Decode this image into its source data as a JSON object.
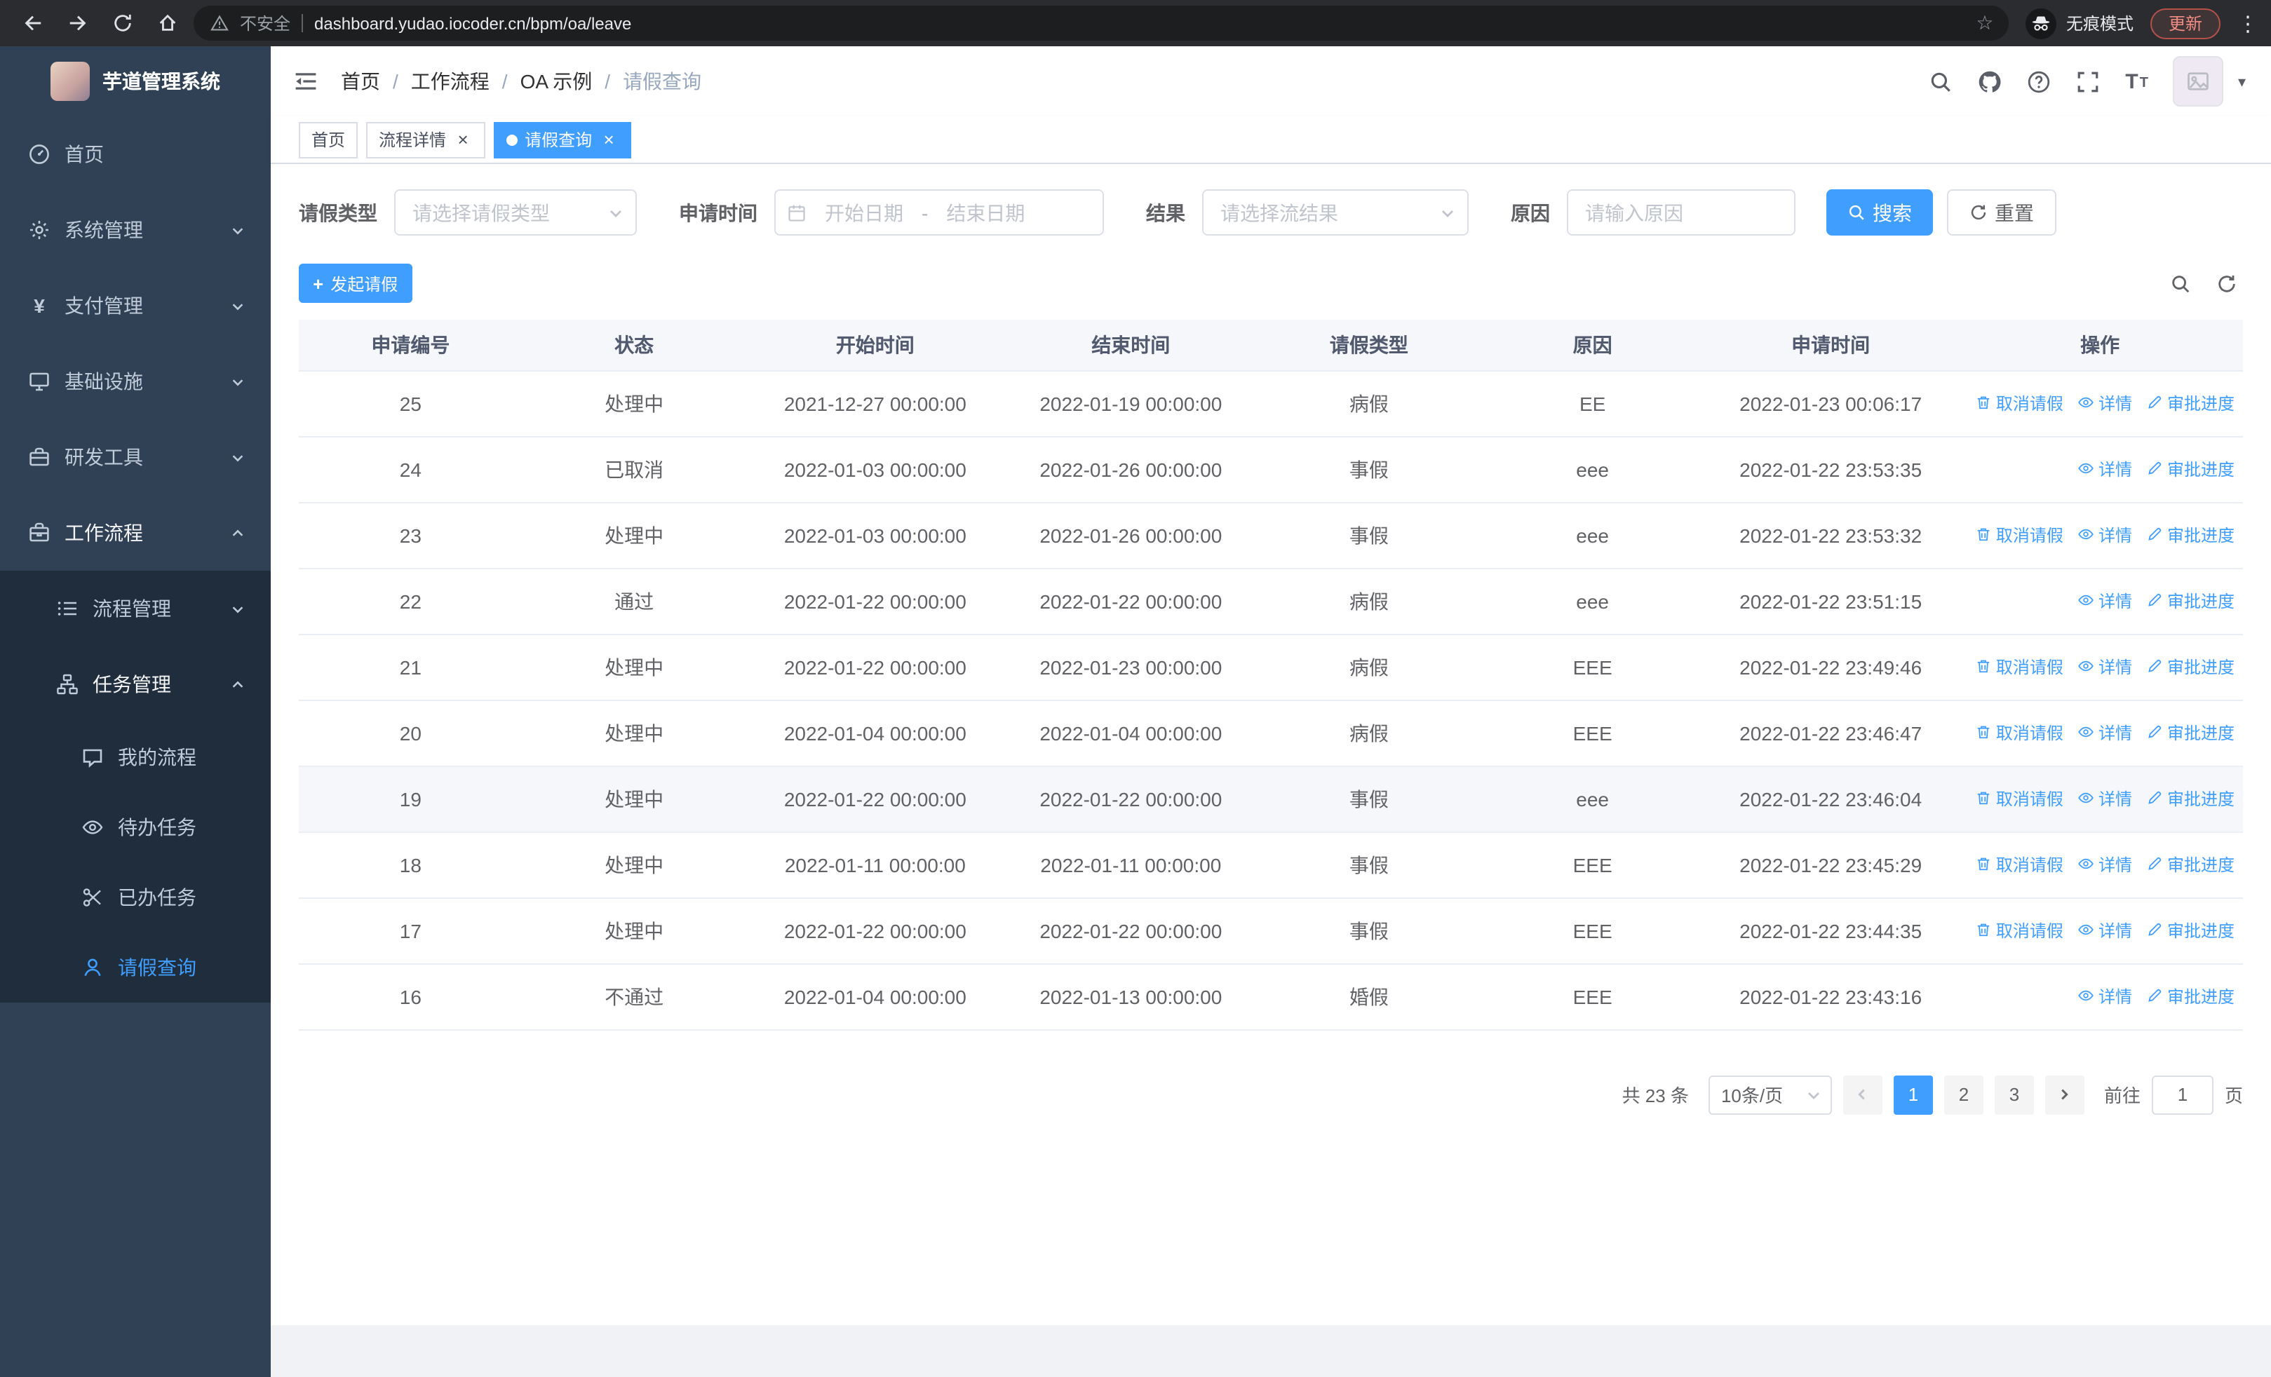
{
  "browser": {
    "url": "dashboard.yudao.iocoder.cn/bpm/oa/leave",
    "security_warning": "不安全",
    "incognito_label": "无痕模式",
    "update_label": "更新"
  },
  "icons": {
    "star": "☆",
    "menu_dots": "⋮",
    "plus": "+",
    "close": "×",
    "caret_down": "▾",
    "font_size": "T"
  },
  "sidebar": {
    "app_title": "芋道管理系统",
    "items": [
      {
        "key": "home",
        "label": "首页",
        "icon": "dashboard-icon",
        "level": 1
      },
      {
        "key": "system",
        "label": "系统管理",
        "icon": "gear-icon",
        "level": 1,
        "expandable": true,
        "expanded": false
      },
      {
        "key": "payment",
        "label": "支付管理",
        "icon": "yen-icon",
        "level": 1,
        "expandable": true,
        "expanded": false
      },
      {
        "key": "infrastructure",
        "label": "基础设施",
        "icon": "monitor-icon",
        "level": 1,
        "expandable": true,
        "expanded": false
      },
      {
        "key": "dev-tools",
        "label": "研发工具",
        "icon": "toolbox-icon",
        "level": 1,
        "expandable": true,
        "expanded": false
      },
      {
        "key": "workflow",
        "label": "工作流程",
        "icon": "briefcase-icon",
        "level": 1,
        "expandable": true,
        "expanded": true,
        "open": true
      },
      {
        "key": "process-mgmt",
        "label": "流程管理",
        "icon": "list-icon",
        "level": 2,
        "expandable": true,
        "expanded": false
      },
      {
        "key": "task-mgmt",
        "label": "任务管理",
        "icon": "org-icon",
        "level": 2,
        "expandable": true,
        "expanded": true,
        "open": true
      },
      {
        "key": "my-process",
        "label": "我的流程",
        "icon": "chat-icon",
        "level": 3
      },
      {
        "key": "todo-task",
        "label": "待办任务",
        "icon": "eye-icon",
        "level": 3
      },
      {
        "key": "done-task",
        "label": "已办任务",
        "icon": "scissors-icon",
        "level": 3
      },
      {
        "key": "leave-query",
        "label": "请假查询",
        "icon": "user-icon",
        "level": 3,
        "active": true
      }
    ]
  },
  "header": {
    "breadcrumbs": [
      "首页",
      "工作流程",
      "OA 示例",
      "请假查询"
    ],
    "separator": "/"
  },
  "tabs": [
    {
      "key": "home",
      "label": "首页",
      "closable": false,
      "active": false
    },
    {
      "key": "process-detail",
      "label": "流程详情",
      "closable": true,
      "active": false
    },
    {
      "key": "leave-query",
      "label": "请假查询",
      "closable": true,
      "active": true
    }
  ],
  "filters": {
    "leave_type_label": "请假类型",
    "leave_type_placeholder": "请选择请假类型",
    "apply_time_label": "申请时间",
    "start_date_placeholder": "开始日期",
    "range_separator": "-",
    "end_date_placeholder": "结束日期",
    "result_label": "结果",
    "result_placeholder": "请选择流结果",
    "reason_label": "原因",
    "reason_placeholder": "请输入原因",
    "search_label": "搜索",
    "reset_label": "重置"
  },
  "toolbar": {
    "create_label": "发起请假"
  },
  "table": {
    "columns": [
      "申请编号",
      "状态",
      "开始时间",
      "结束时间",
      "请假类型",
      "原因",
      "申请时间",
      "操作"
    ],
    "action_labels": {
      "cancel": "取消请假",
      "detail": "详情",
      "progress": "审批进度"
    },
    "rows": [
      {
        "id": "25",
        "status": "处理中",
        "start": "2021-12-27 00:00:00",
        "end": "2022-01-19 00:00:00",
        "type": "病假",
        "reason": "EE",
        "applied": "2022-01-23 00:06:17",
        "actions": [
          "cancel",
          "detail",
          "progress"
        ]
      },
      {
        "id": "24",
        "status": "已取消",
        "start": "2022-01-03 00:00:00",
        "end": "2022-01-26 00:00:00",
        "type": "事假",
        "reason": "eee",
        "applied": "2022-01-22 23:53:35",
        "actions": [
          "detail",
          "progress"
        ]
      },
      {
        "id": "23",
        "status": "处理中",
        "start": "2022-01-03 00:00:00",
        "end": "2022-01-26 00:00:00",
        "type": "事假",
        "reason": "eee",
        "applied": "2022-01-22 23:53:32",
        "actions": [
          "cancel",
          "detail",
          "progress"
        ]
      },
      {
        "id": "22",
        "status": "通过",
        "start": "2022-01-22 00:00:00",
        "end": "2022-01-22 00:00:00",
        "type": "病假",
        "reason": "eee",
        "applied": "2022-01-22 23:51:15",
        "actions": [
          "detail",
          "progress"
        ]
      },
      {
        "id": "21",
        "status": "处理中",
        "start": "2022-01-22 00:00:00",
        "end": "2022-01-23 00:00:00",
        "type": "病假",
        "reason": "EEE",
        "applied": "2022-01-22 23:49:46",
        "actions": [
          "cancel",
          "detail",
          "progress"
        ]
      },
      {
        "id": "20",
        "status": "处理中",
        "start": "2022-01-04 00:00:00",
        "end": "2022-01-04 00:00:00",
        "type": "病假",
        "reason": "EEE",
        "applied": "2022-01-22 23:46:47",
        "actions": [
          "cancel",
          "detail",
          "progress"
        ]
      },
      {
        "id": "19",
        "status": "处理中",
        "start": "2022-01-22 00:00:00",
        "end": "2022-01-22 00:00:00",
        "type": "事假",
        "reason": "eee",
        "applied": "2022-01-22 23:46:04",
        "actions": [
          "cancel",
          "detail",
          "progress"
        ],
        "highlight": true
      },
      {
        "id": "18",
        "status": "处理中",
        "start": "2022-01-11 00:00:00",
        "end": "2022-01-11 00:00:00",
        "type": "事假",
        "reason": "EEE",
        "applied": "2022-01-22 23:45:29",
        "actions": [
          "cancel",
          "detail",
          "progress"
        ]
      },
      {
        "id": "17",
        "status": "处理中",
        "start": "2022-01-22 00:00:00",
        "end": "2022-01-22 00:00:00",
        "type": "事假",
        "reason": "EEE",
        "applied": "2022-01-22 23:44:35",
        "actions": [
          "cancel",
          "detail",
          "progress"
        ]
      },
      {
        "id": "16",
        "status": "不通过",
        "start": "2022-01-04 00:00:00",
        "end": "2022-01-13 00:00:00",
        "type": "婚假",
        "reason": "EEE",
        "applied": "2022-01-22 23:43:16",
        "actions": [
          "detail",
          "progress"
        ]
      }
    ]
  },
  "pagination": {
    "total_label": "共 23 条",
    "page_size": "10条/页",
    "pages": [
      "1",
      "2",
      "3"
    ],
    "active_page": "1",
    "goto_label": "前往",
    "goto_value": "1",
    "page_unit": "页"
  }
}
